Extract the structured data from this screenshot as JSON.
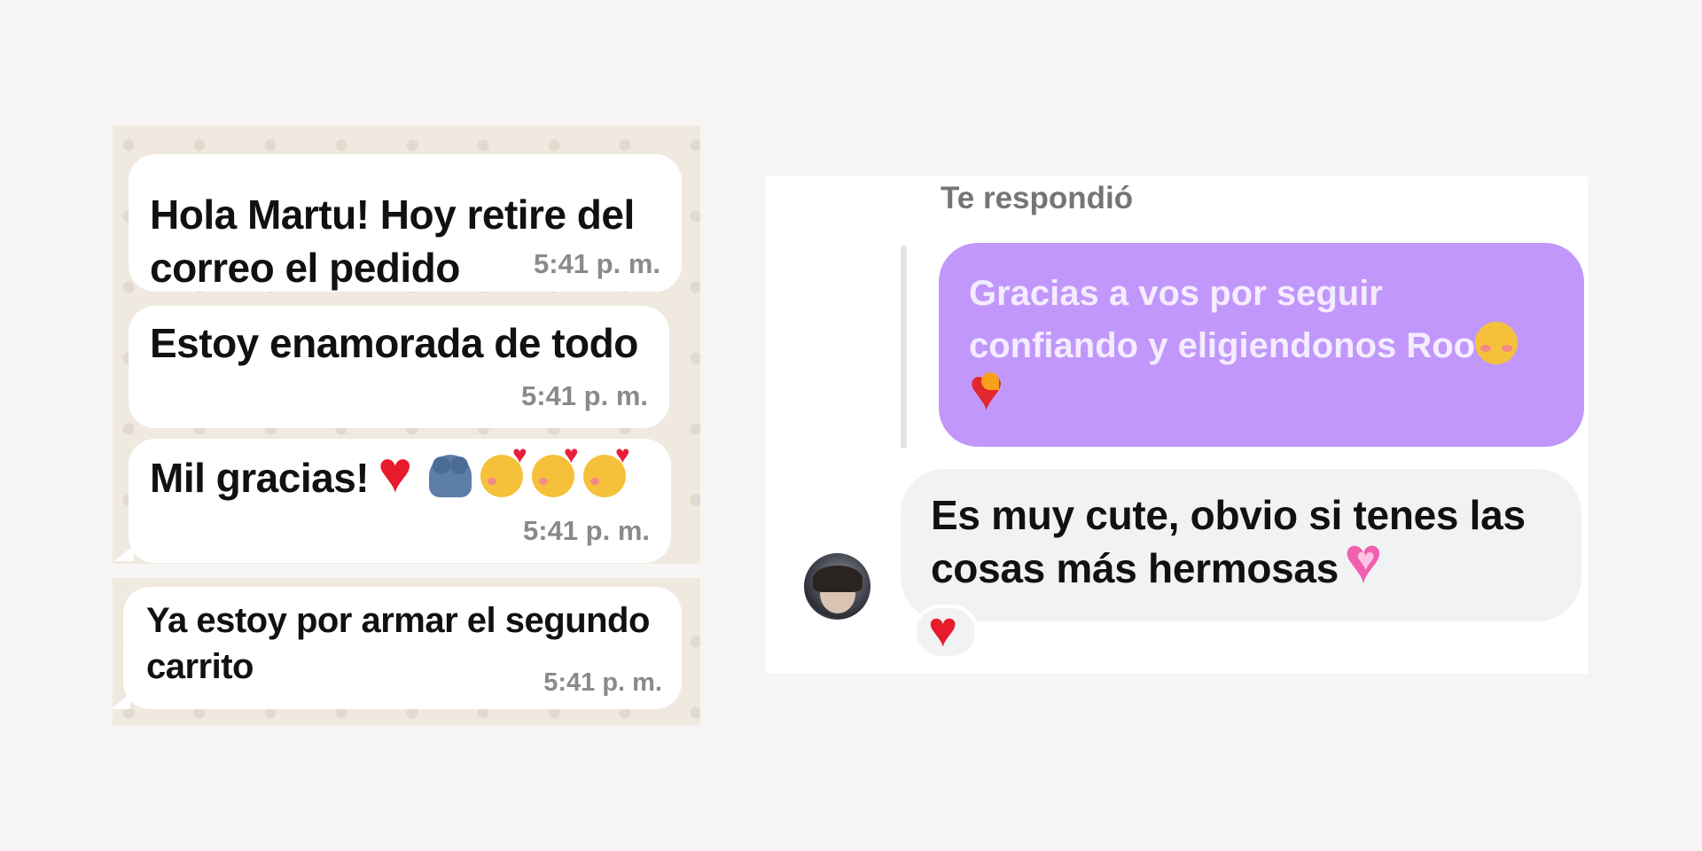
{
  "whatsapp": {
    "messages": [
      {
        "text": "Hola Martu! Hoy retire del correo el pedido",
        "line1": "Hola Martu! Hoy retire del",
        "line2": "correo el pedido",
        "time": "5:41 p. m."
      },
      {
        "text": "Estoy enamorada de todo",
        "time": "5:41 p. m."
      },
      {
        "text": "Mil gracias!",
        "emojis": [
          "red-heart-icon",
          "people-hugging-icon",
          "smiling-face-with-hearts-icon",
          "smiling-face-with-hearts-icon",
          "smiling-face-with-hearts-icon"
        ],
        "time": "5:41 p. m."
      },
      {
        "text": "Ya estoy por armar el segundo carrito",
        "line1": "Ya estoy por armar el segundo",
        "line2": "carrito",
        "time": "5:41 p. m."
      }
    ],
    "colors": {
      "wallpaper": "#efe9df",
      "bubble": "#ffffff",
      "time": "#8a8a8a"
    }
  },
  "instagram": {
    "replied_label": "Te respondió",
    "quoted_message": {
      "line1": "Gracias a vos por seguir",
      "line2": "confiando y eligiendonos Roo",
      "emojis": [
        "smiling-face-icon",
        "heart-on-fire-icon"
      ]
    },
    "received_message": {
      "line1": "Es muy cute, obvio si tenes las",
      "line2": "cosas más hermosas",
      "emoji": "growing-heart-icon"
    },
    "reaction": "red-heart-icon",
    "colors": {
      "quoted_bubble": "#c197fb",
      "received_bubble": "#f1f2f4",
      "label": "#757575"
    }
  }
}
